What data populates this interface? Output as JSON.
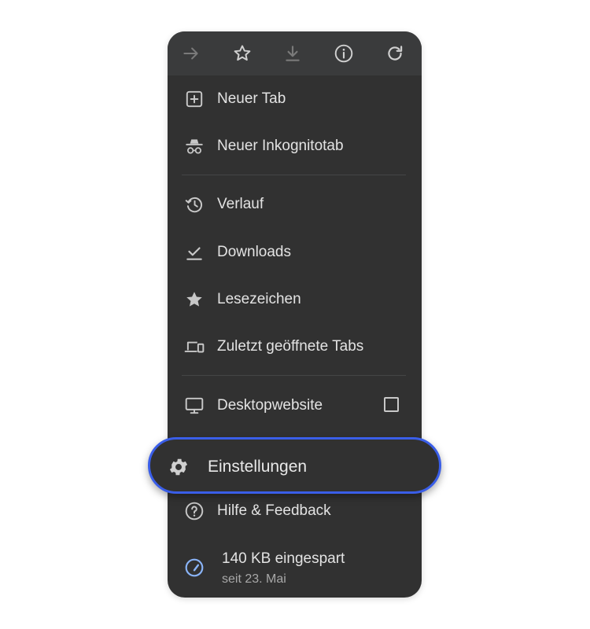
{
  "toolbar": {
    "icons": [
      "forward-arrow-icon",
      "star-outline-icon",
      "download-icon",
      "info-icon",
      "reload-icon"
    ]
  },
  "menu": {
    "items": [
      {
        "label": "Neuer Tab",
        "icon": "add-box-icon"
      },
      {
        "label": "Neuer Inkognitotab",
        "icon": "incognito-icon"
      },
      {
        "label": "Verlauf",
        "icon": "history-icon"
      },
      {
        "label": "Downloads",
        "icon": "download-done-icon"
      },
      {
        "label": "Lesezeichen",
        "icon": "star-filled-icon"
      },
      {
        "label": "Zuletzt geöffnete Tabs",
        "icon": "devices-icon"
      },
      {
        "label": "Desktopwebsite",
        "icon": "monitor-icon",
        "checked": false
      },
      {
        "label": "Einstellungen",
        "icon": "gear-icon",
        "highlighted": true
      },
      {
        "label": "Hilfe & Feedback",
        "icon": "help-circle-icon"
      }
    ],
    "savings": {
      "title": "140 KB eingespart",
      "subtitle": "seit 23. Mai",
      "icon": "speedometer-icon"
    }
  },
  "colors": {
    "menu_bg": "#313131",
    "toolbar_bg": "#3a3b3c",
    "text": "#e3e3e3",
    "icon": "#c8c8c8",
    "highlight_border": "#3a5ee8",
    "accent_icon": "#8ab4f8"
  }
}
